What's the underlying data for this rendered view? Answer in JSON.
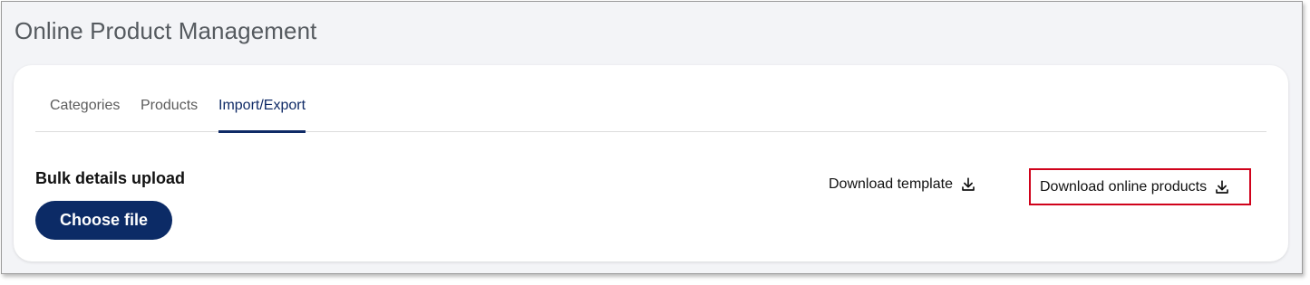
{
  "header": {
    "title": "Online Product Management"
  },
  "tabs": [
    {
      "label": "Categories",
      "active": false
    },
    {
      "label": "Products",
      "active": false
    },
    {
      "label": "Import/Export",
      "active": true
    }
  ],
  "upload": {
    "title": "Bulk details upload",
    "button_label": "Choose file"
  },
  "downloads": {
    "template_label": "Download template",
    "products_label": "Download online products",
    "icon": "download-icon",
    "highlight_color": "#d0021b"
  },
  "colors": {
    "primary": "#0c2b66",
    "active_tab": "#0f2a66",
    "background": "#f3f4f7"
  }
}
